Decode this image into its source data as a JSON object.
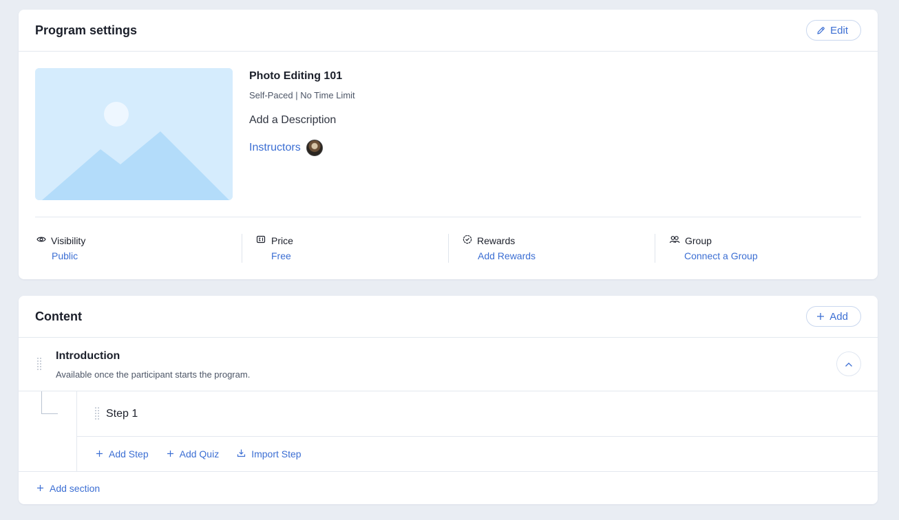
{
  "settings": {
    "title": "Program settings",
    "edit_label": "Edit",
    "program": {
      "name": "Photo Editing 101",
      "meta": "Self-Paced | No Time Limit",
      "description": "Add a Description",
      "instructors_label": "Instructors"
    },
    "stats": [
      {
        "icon": "eye-icon",
        "label": "Visibility",
        "value": "Public"
      },
      {
        "icon": "price-tag-icon",
        "label": "Price",
        "value": "Free"
      },
      {
        "icon": "badge-check-icon",
        "label": "Rewards",
        "value": "Add Rewards"
      },
      {
        "icon": "group-icon",
        "label": "Group",
        "value": "Connect a Group"
      }
    ]
  },
  "content": {
    "title": "Content",
    "add_label": "Add",
    "section": {
      "title": "Introduction",
      "subtitle": "Available once the participant starts the program."
    },
    "steps": [
      {
        "label": "Step 1"
      }
    ],
    "actions": {
      "add_step": "Add Step",
      "add_quiz": "Add Quiz",
      "import_step": "Import Step"
    },
    "add_section": "Add section"
  },
  "colors": {
    "accent": "#3b6ed3",
    "background": "#e9edf3",
    "thumbnail": "#d5ecfd"
  }
}
